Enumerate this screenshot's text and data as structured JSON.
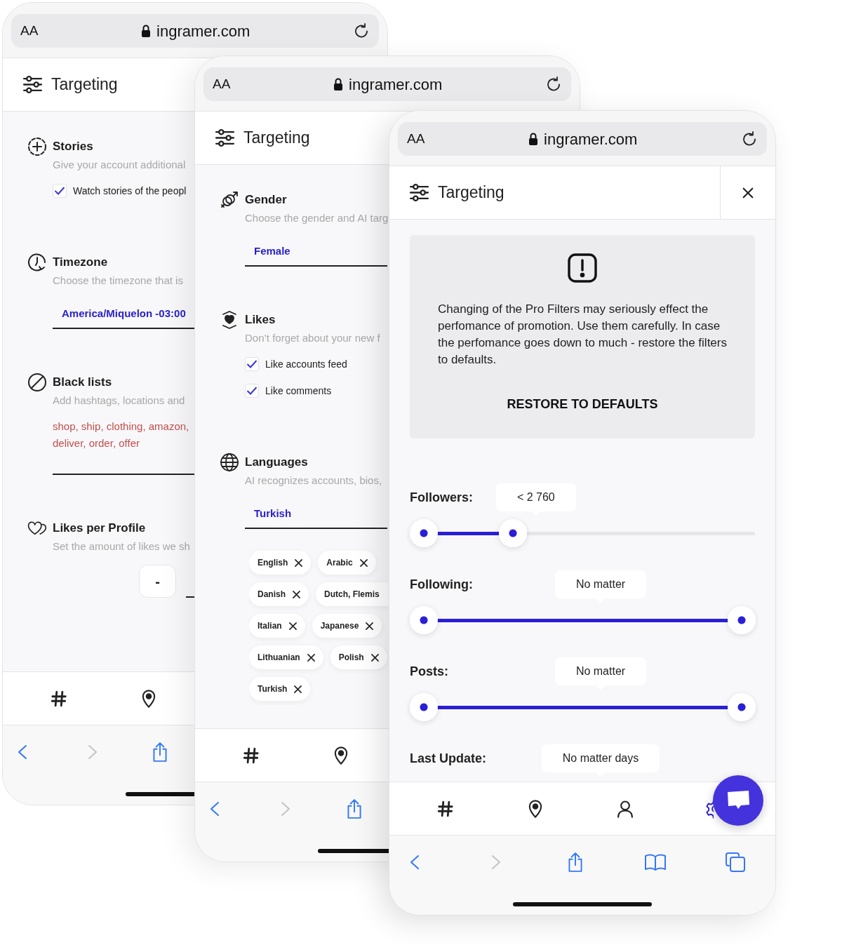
{
  "phones": [
    {
      "address_bar": {
        "text_size": "AA",
        "url": "ingramer.com"
      },
      "header": {
        "title": "Targeting"
      },
      "sections": [
        {
          "kind": "checks",
          "title": "Stories",
          "description": "Give your account additional",
          "options": [
            {
              "label": "Watch stories of the peopl",
              "checked": true
            }
          ]
        },
        {
          "kind": "select",
          "title": "Timezone",
          "description": "Choose the timezone that is",
          "value": "America/Miquelon -03:00"
        },
        {
          "kind": "list",
          "title": "Black lists",
          "description": "Add hashtags, locations and",
          "value": "shop, ship, clothing, amazon, deliver, order, offer"
        },
        {
          "kind": "stepper",
          "title": "Likes per Profile",
          "description": "Set the amount of likes we sh",
          "decrement": "-"
        }
      ]
    },
    {
      "address_bar": {
        "text_size": "AA",
        "url": "ingramer.com"
      },
      "header": {
        "title": "Targeting"
      },
      "sections": [
        {
          "kind": "select",
          "title": "Gender",
          "description": "Choose the gender and AI targ",
          "value": "Female"
        },
        {
          "kind": "checks",
          "title": "Likes",
          "description": "Don’t forget about your new f",
          "options": [
            {
              "label": "Like accounts feed",
              "checked": true
            },
            {
              "label": "Like comments",
              "checked": true
            }
          ]
        },
        {
          "kind": "tags",
          "title": "Languages",
          "description": "AI recognizes accounts, bios,",
          "value": "Turkish",
          "tags": [
            {
              "label": "English",
              "removable": true
            },
            {
              "label": "Arabic",
              "removable": true
            },
            {
              "label": "Danish",
              "removable": true
            },
            {
              "label": "Dutch, Flemis",
              "removable": false
            },
            {
              "label": "Italian",
              "removable": true
            },
            {
              "label": "Japanese",
              "removable": true
            },
            {
              "label": "Lithuanian",
              "removable": true
            },
            {
              "label": "Polish",
              "removable": true
            },
            {
              "label": "Turkish",
              "removable": true
            }
          ]
        }
      ]
    },
    {
      "address_bar": {
        "text_size": "AA",
        "url": "ingramer.com"
      },
      "header": {
        "title": "Targeting"
      },
      "alert": {
        "message": "Changing of the Pro Filters may seriously effect the perfomance of promotion. Use them carefully. In case the perfomance goes down to much - restore the filters to defaults.",
        "action": "RESTORE TO DEFAULTS"
      },
      "filters": [
        {
          "label": "Followers:",
          "value": "< 2 760",
          "thumbs": [
            {
              "level": 0
            },
            {
              "level": 0.28
            }
          ]
        },
        {
          "label": "Following:",
          "value": "No matter",
          "thumbs": [
            {
              "level": 0
            },
            {
              "level": 1
            }
          ]
        },
        {
          "label": "Posts:",
          "value": "No matter",
          "thumbs": [
            {
              "level": 0
            },
            {
              "level": 1
            }
          ]
        },
        {
          "label": "Last Update:",
          "value": "No matter days"
        }
      ]
    }
  ]
}
